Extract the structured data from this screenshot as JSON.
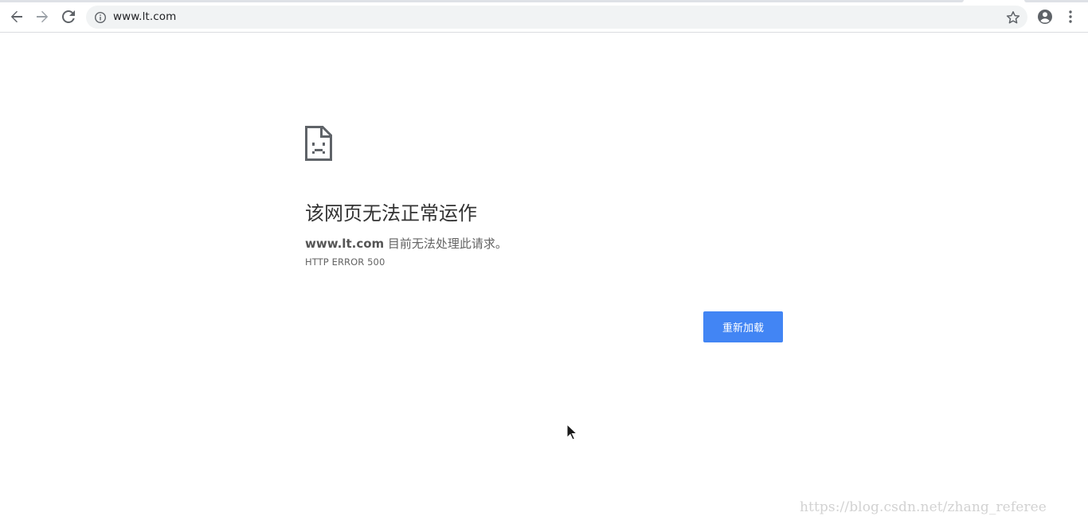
{
  "browser": {
    "url": "www.lt.com",
    "icons": {
      "back": "arrow-left-icon",
      "forward": "arrow-right-icon",
      "reload": "reload-icon",
      "site_info": "info-icon",
      "bookmark": "star-icon",
      "profile": "account-circle-icon",
      "menu": "vertical-dots-icon"
    }
  },
  "error_page": {
    "icon": "sad-page-icon",
    "heading": "该网页无法正常运作",
    "host": "www.lt.com",
    "summary": " 目前无法处理此请求。",
    "error_code": "HTTP ERROR 500",
    "reload_label": "重新加载",
    "accent_color": "#4285f4"
  },
  "watermark": "https://blog.csdn.net/zhang_referee"
}
